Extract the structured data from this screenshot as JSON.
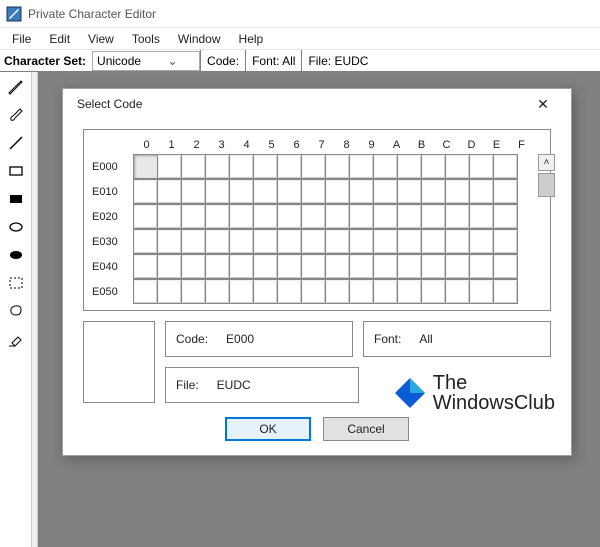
{
  "app": {
    "title": "Private Character Editor"
  },
  "menubar": [
    "File",
    "Edit",
    "View",
    "Tools",
    "Window",
    "Help"
  ],
  "toolbar": {
    "charset_label": "Character Set:",
    "charset_value": "Unicode",
    "code_label": "Code:",
    "font_label": "Font:",
    "font_value": "All",
    "file_label": "File:",
    "file_value": "EUDC"
  },
  "tools": [
    {
      "name": "pencil-tool-icon"
    },
    {
      "name": "brush-tool-icon"
    },
    {
      "name": "line-tool-icon"
    },
    {
      "name": "rect-outline-tool-icon"
    },
    {
      "name": "rect-filled-tool-icon"
    },
    {
      "name": "ellipse-outline-tool-icon"
    },
    {
      "name": "ellipse-filled-tool-icon"
    },
    {
      "name": "rect-select-tool-icon"
    },
    {
      "name": "free-select-tool-icon"
    },
    {
      "name": "eraser-tool-icon"
    }
  ],
  "dialog": {
    "title": "Select Code",
    "columns": [
      "0",
      "1",
      "2",
      "3",
      "4",
      "5",
      "6",
      "7",
      "8",
      "9",
      "A",
      "B",
      "C",
      "D",
      "E",
      "F"
    ],
    "rows": [
      "E000",
      "E010",
      "E020",
      "E030",
      "E040",
      "E050"
    ],
    "selected_cell": {
      "row": 0,
      "col": 0
    },
    "info": {
      "code_label": "Code:",
      "code_value": "E000",
      "font_label": "Font:",
      "font_value": "All",
      "file_label": "File:",
      "file_value": "EUDC"
    },
    "buttons": {
      "ok": "OK",
      "cancel": "Cancel"
    }
  },
  "watermark": {
    "line1": "The",
    "line2": "WindowsClub"
  }
}
